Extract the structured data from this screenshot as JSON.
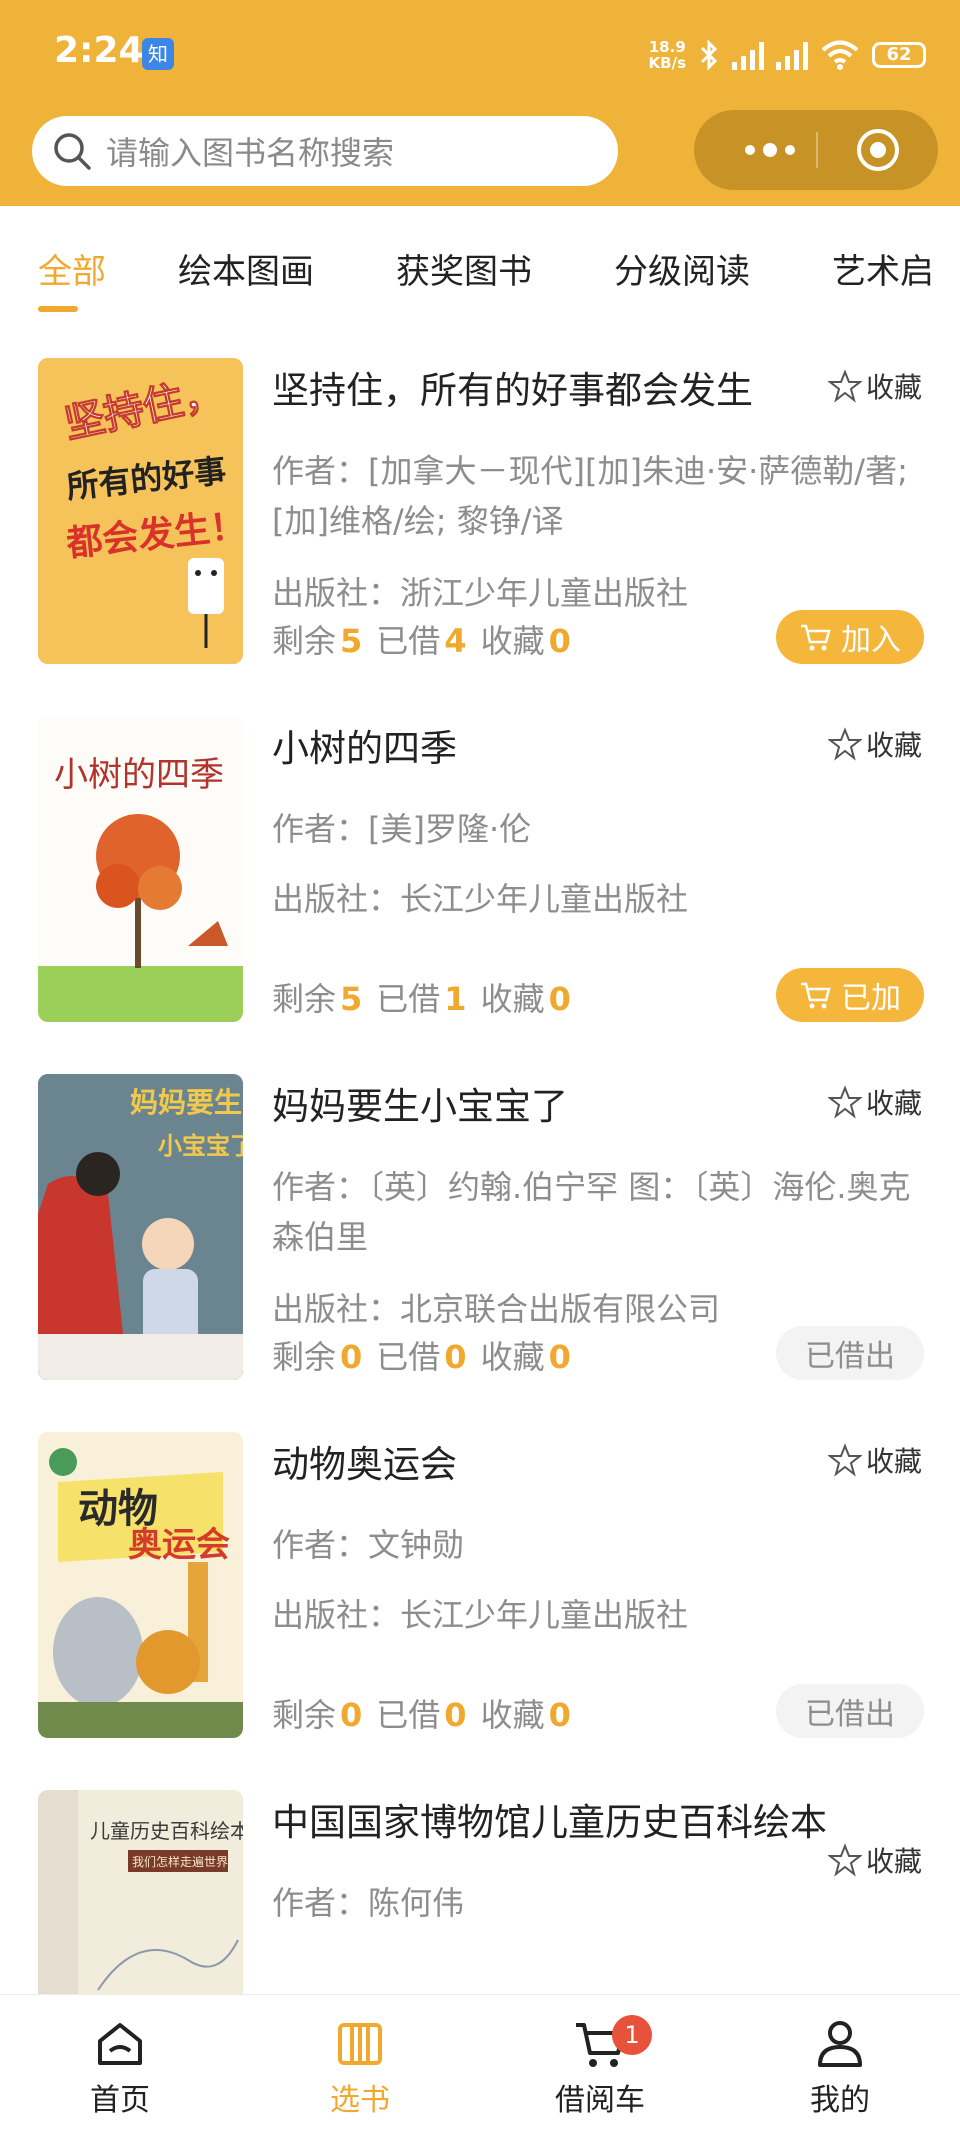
{
  "status_bar": {
    "time": "2:24",
    "app_badge": "知",
    "net_speed_value": "18.9",
    "net_speed_unit": "KB/s",
    "battery": "62"
  },
  "search": {
    "placeholder": "请输入图书名称搜索"
  },
  "colors": {
    "brand": "#f0b33a",
    "accent": "#f0a92e",
    "badge": "#e8523b"
  },
  "tabs": [
    {
      "label": "全部",
      "active": true
    },
    {
      "label": "绘本图画",
      "active": false
    },
    {
      "label": "获奖图书",
      "active": false
    },
    {
      "label": "分级阅读",
      "active": false
    },
    {
      "label": "艺术启",
      "active": false
    }
  ],
  "labels": {
    "favorite": "收藏",
    "remaining": "剩余",
    "borrowed": "已借",
    "favorites": "收藏"
  },
  "books": [
    {
      "title": "坚持住，所有的好事都会发生",
      "author": "作者：[加拿大－现代][加]朱迪·安·萨德勒/著; [加]维格/绘; 黎铮/译",
      "publisher": "出版社：浙江少年儿童出版社",
      "remaining": "5",
      "borrowed": "4",
      "favorites": "0",
      "action": "加入",
      "cover_text": [
        "坚持住，",
        "所有的好事",
        "都会发生！"
      ]
    },
    {
      "title": "小树的四季",
      "author": "作者：[美]罗隆·伦",
      "publisher": "出版社：长江少年儿童出版社",
      "remaining": "5",
      "borrowed": "1",
      "favorites": "0",
      "action": "已加",
      "cover_text": [
        "小树的四季"
      ]
    },
    {
      "title": "妈妈要生小宝宝了",
      "author": "作者：〔英〕约翰.伯宁罕 图：〔英〕海伦.奥克森伯里",
      "publisher": "出版社：北京联合出版有限公司",
      "remaining": "0",
      "borrowed": "0",
      "favorites": "0",
      "action": "已借出",
      "cover_text": [
        "妈妈要生",
        "小宝宝了"
      ]
    },
    {
      "title": "动物奥运会",
      "author": "作者：文钟勋",
      "publisher": "出版社：长江少年儿童出版社",
      "remaining": "0",
      "borrowed": "0",
      "favorites": "0",
      "action": "已借出",
      "cover_text": [
        "动物",
        "奥运会"
      ]
    },
    {
      "title": "中国国家博物馆儿童历史百科绘本",
      "author": "作者：陈何伟",
      "cover_text": [
        "儿童历史百科绘本",
        "我们怎样走遍世界"
      ]
    }
  ],
  "bottom_nav": [
    {
      "label": "首页",
      "icon": "home-icon"
    },
    {
      "label": "选书",
      "icon": "books-icon"
    },
    {
      "label": "借阅车",
      "icon": "cart-icon",
      "badge": "1"
    },
    {
      "label": "我的",
      "icon": "user-icon"
    }
  ]
}
